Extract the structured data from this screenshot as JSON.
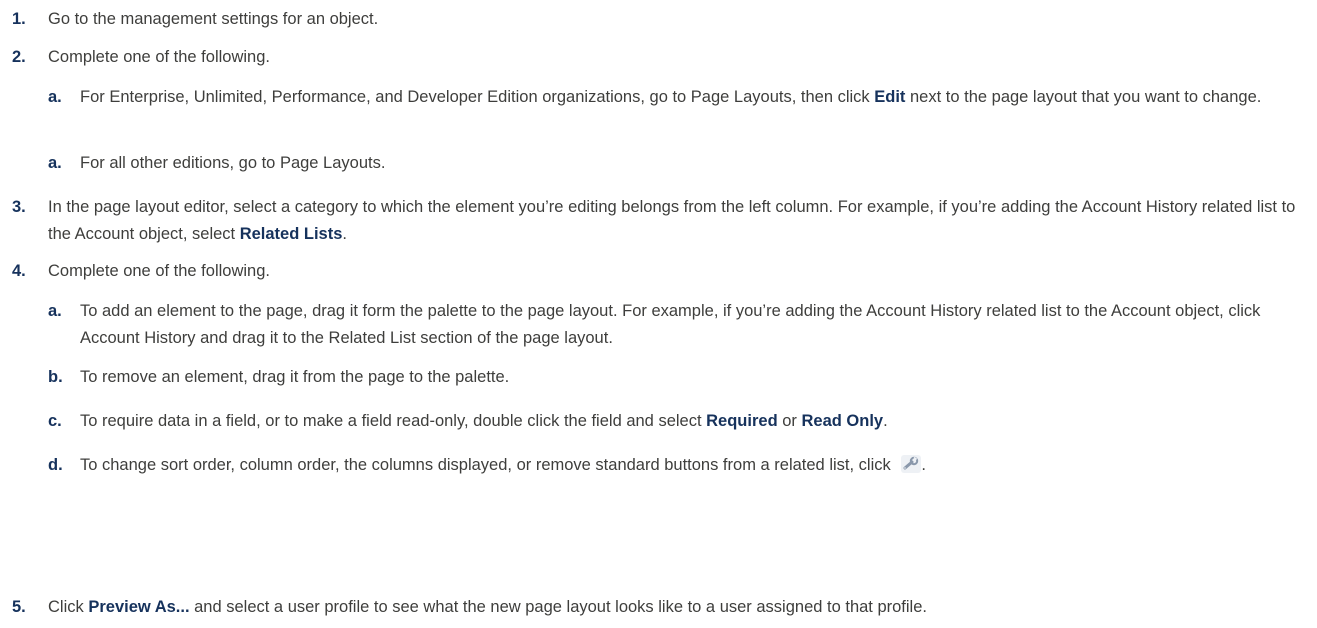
{
  "steps": [
    {
      "num": "1.",
      "text": "Go to the management settings for an object."
    },
    {
      "num": "2.",
      "text": "Complete one of the following."
    },
    {
      "num": "3.",
      "pre": "In the page layout editor, select a category to which the element you’re editing belongs from the left column. For example, if you’re adding the Account History related list to the Account object, select ",
      "bold": "Related Lists",
      "post": "."
    },
    {
      "num": "4.",
      "text": "Complete one of the following."
    },
    {
      "num": "5.",
      "pre": "Click ",
      "bold": "Preview As...",
      "post": " and select a user profile to see what the new page layout looks like to a user assigned to that profile."
    }
  ],
  "step2_subs": [
    {
      "num": "a.",
      "pre": "For Enterprise, Unlimited, Performance, and Developer Edition organizations, go to Page Layouts, then click ",
      "bold": "Edit",
      "post": " next to the page layout that you want to change."
    },
    {
      "num": "a.",
      "text": "For all other editions, go to Page Layouts."
    }
  ],
  "step4_subs": [
    {
      "num": "a.",
      "text": "To add an element to the page, drag it form the palette to the page layout. For example, if you’re adding the Account History related list to the Account object, click Account History and drag it to the Related List section of the page layout."
    },
    {
      "num": "b.",
      "text": "To remove an element, drag it from the page to the palette."
    },
    {
      "num": "c.",
      "pre": "To require data in a field, or to make a field read-only, double click the field and select ",
      "bold1": "Required",
      "mid": " or ",
      "bold2": "Read Only",
      "post": "."
    },
    {
      "num": "d.",
      "pre": "To change sort order, column order, the columns displayed, or remove standard buttons from a related list, click ",
      "icon": "wrench-icon",
      "post": "."
    }
  ]
}
